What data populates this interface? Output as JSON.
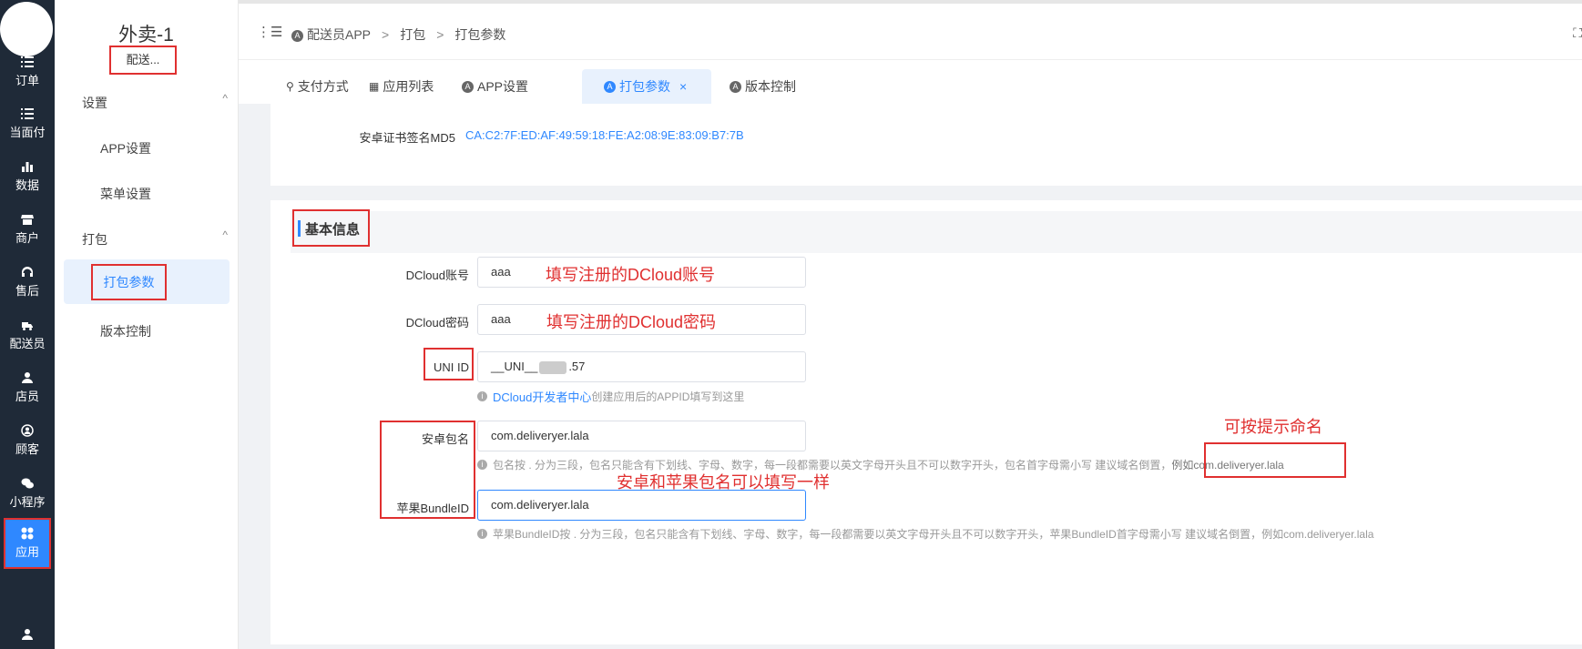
{
  "rail": {
    "items": [
      {
        "label": "订单",
        "icon": "list-icon"
      },
      {
        "label": "当面付",
        "icon": "list-icon"
      },
      {
        "label": "数据",
        "icon": "bar-chart-icon"
      },
      {
        "label": "商户",
        "icon": "store-icon"
      },
      {
        "label": "售后",
        "icon": "headset-icon"
      },
      {
        "label": "配送员",
        "icon": "delivery-icon"
      },
      {
        "label": "店员",
        "icon": "user-icon"
      },
      {
        "label": "顾客",
        "icon": "customer-icon"
      },
      {
        "label": "小程序",
        "icon": "wechat-icon"
      },
      {
        "label": "应用",
        "icon": "grid-icon"
      }
    ]
  },
  "sidebar": {
    "store_name": "外卖-1",
    "store_sub": "配送...",
    "groups": [
      {
        "label": "设置",
        "items": [
          "APP设置",
          "菜单设置"
        ]
      },
      {
        "label": "打包",
        "items": [
          "打包参数",
          "版本控制"
        ]
      }
    ],
    "chevron": "^"
  },
  "topbar": {
    "collapse": "⋮☰",
    "breadcrumb": [
      "配送员APP",
      "打包",
      "打包参数"
    ],
    "sep": ">",
    "fullscreen": "⛶"
  },
  "tabs": [
    {
      "label": "支付方式",
      "icon": "user-icon"
    },
    {
      "label": "应用列表",
      "icon": "grid-icon"
    },
    {
      "label": "APP设置",
      "icon": "app-icon"
    },
    {
      "label": "打包参数",
      "icon": "app-icon",
      "active": true
    },
    {
      "label": "版本控制",
      "icon": "app-icon"
    }
  ],
  "tab_close": "×",
  "cert": {
    "label": "安卓证书签名MD5",
    "value": "CA:C2:7F:ED:AF:49:59:18:FE:A2:08:9E:83:09:B7:7B"
  },
  "section_title": "基本信息",
  "form": {
    "dcloud_account": {
      "label": "DCloud账号",
      "value": "aaa"
    },
    "dcloud_password": {
      "label": "DCloud密码",
      "value": "aaa"
    },
    "uni_id": {
      "label": "UNI ID",
      "value_prefix": "__UNI__",
      "value_suffix": ".57"
    },
    "uni_hint": {
      "link": "DCloud开发者中心",
      "text": " 创建应用后的APPID填写到这里"
    },
    "android_package": {
      "label": "安卓包名",
      "value": "com.deliveryer.lala"
    },
    "android_hint": "包名按 . 分为三段，包名只能含有下划线、字母、数字，每一段都需要以英文字母开头且不可以数字开头，包名首字母需小写 建议域名倒置，",
    "android_hint_example": "例如com.deliveryer.lala",
    "ios_bundle": {
      "label": "苹果BundleID",
      "value": "com.deliveryer.lala"
    },
    "ios_hint": "苹果BundleID按 . 分为三段，包名只能含有下划线、字母、数字，每一段都需要以英文字母开头且不可以数字开头，苹果BundleID首字母需小写 建议域名倒置，例如com.deliveryer.lala"
  },
  "annotations": {
    "account": "填写注册的DCloud账号",
    "password": "填写注册的DCloud密码",
    "naming": "可按提示命名",
    "same": "安卓和苹果包名可以填写一样"
  },
  "colors": {
    "accent": "#2f88ff",
    "annotation": "#e03030",
    "rail_bg": "#1f2a38"
  }
}
